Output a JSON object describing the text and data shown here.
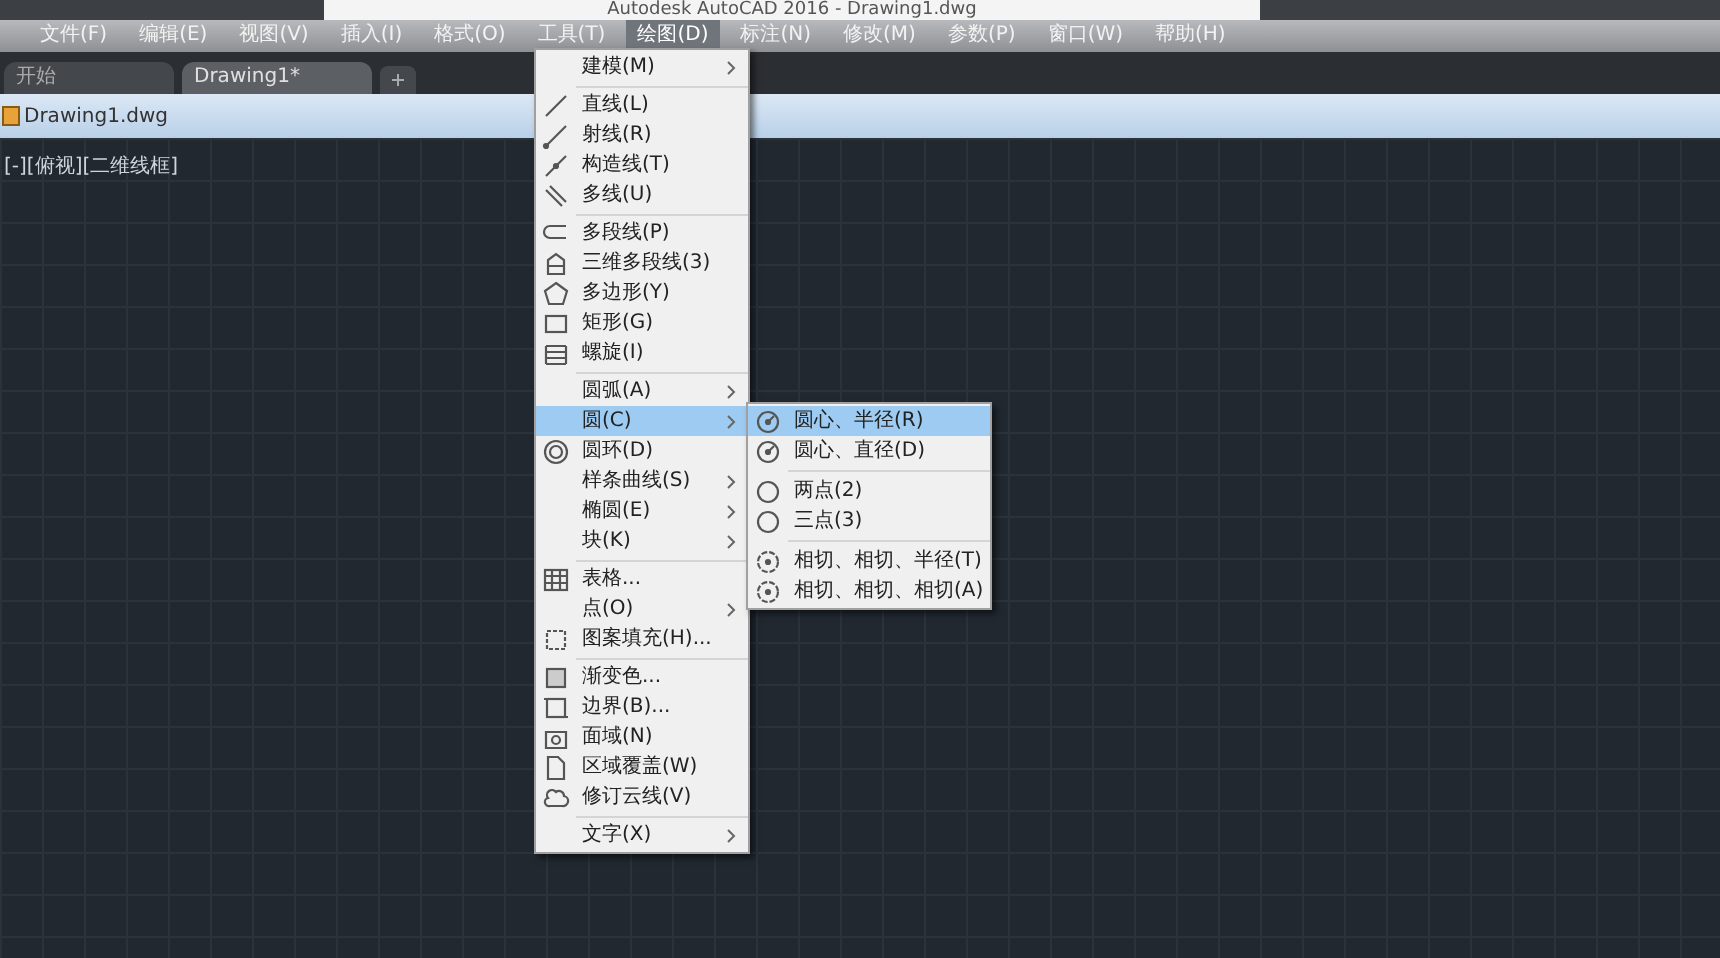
{
  "window": {
    "title": "Autodesk AutoCAD 2016 - Drawing1.dwg"
  },
  "menubar": [
    {
      "label": "文件(F)",
      "selected": false
    },
    {
      "label": "编辑(E)",
      "selected": false
    },
    {
      "label": "视图(V)",
      "selected": false
    },
    {
      "label": "插入(I)",
      "selected": false
    },
    {
      "label": "格式(O)",
      "selected": false
    },
    {
      "label": "工具(T)",
      "selected": false
    },
    {
      "label": "绘图(D)",
      "selected": true
    },
    {
      "label": "标注(N)",
      "selected": false
    },
    {
      "label": "修改(M)",
      "selected": false
    },
    {
      "label": "参数(P)",
      "selected": false
    },
    {
      "label": "窗口(W)",
      "selected": false
    },
    {
      "label": "帮助(H)",
      "selected": false
    }
  ],
  "file_tabs": [
    {
      "label": "开始",
      "selected": false
    },
    {
      "label": "Drawing1*",
      "selected": true
    }
  ],
  "document": {
    "title": "Drawing1.dwg",
    "viewport_label": "[-][俯视][二维线框]"
  },
  "draw_menu": [
    {
      "kind": "item",
      "label": "建模(M)",
      "submenu": true,
      "selected": false
    },
    {
      "kind": "separator"
    },
    {
      "kind": "item",
      "label": "直线(L)",
      "submenu": false,
      "selected": false
    },
    {
      "kind": "item",
      "label": "射线(R)",
      "submenu": false,
      "selected": false
    },
    {
      "kind": "item",
      "label": "构造线(T)",
      "submenu": false,
      "selected": false
    },
    {
      "kind": "item",
      "label": "多线(U)",
      "submenu": false,
      "selected": false
    },
    {
      "kind": "separator"
    },
    {
      "kind": "item",
      "label": "多段线(P)",
      "submenu": false,
      "selected": false
    },
    {
      "kind": "item",
      "label": "三维多段线(3)",
      "submenu": false,
      "selected": false
    },
    {
      "kind": "item",
      "label": "多边形(Y)",
      "submenu": false,
      "selected": false
    },
    {
      "kind": "item",
      "label": "矩形(G)",
      "submenu": false,
      "selected": false
    },
    {
      "kind": "item",
      "label": "螺旋(I)",
      "submenu": false,
      "selected": false
    },
    {
      "kind": "separator"
    },
    {
      "kind": "item",
      "label": "圆弧(A)",
      "submenu": true,
      "selected": false
    },
    {
      "kind": "item",
      "label": "圆(C)",
      "submenu": true,
      "selected": true
    },
    {
      "kind": "item",
      "label": "圆环(D)",
      "submenu": false,
      "selected": false
    },
    {
      "kind": "item",
      "label": "样条曲线(S)",
      "submenu": true,
      "selected": false
    },
    {
      "kind": "item",
      "label": "椭圆(E)",
      "submenu": true,
      "selected": false
    },
    {
      "kind": "item",
      "label": "块(K)",
      "submenu": true,
      "selected": false
    },
    {
      "kind": "separator"
    },
    {
      "kind": "item",
      "label": "表格...",
      "submenu": false,
      "selected": false
    },
    {
      "kind": "item",
      "label": "点(O)",
      "submenu": true,
      "selected": false
    },
    {
      "kind": "item",
      "label": "图案填充(H)...",
      "submenu": false,
      "selected": false
    },
    {
      "kind": "separator"
    },
    {
      "kind": "item",
      "label": "渐变色...",
      "submenu": false,
      "selected": false
    },
    {
      "kind": "item",
      "label": "边界(B)...",
      "submenu": false,
      "selected": false
    },
    {
      "kind": "item",
      "label": "面域(N)",
      "submenu": false,
      "selected": false
    },
    {
      "kind": "item",
      "label": "区域覆盖(W)",
      "submenu": false,
      "selected": false
    },
    {
      "kind": "item",
      "label": "修订云线(V)",
      "submenu": false,
      "selected": false
    },
    {
      "kind": "separator"
    },
    {
      "kind": "item",
      "label": "文字(X)",
      "submenu": true,
      "selected": false
    }
  ],
  "circle_submenu": [
    {
      "kind": "item",
      "label": "圆心、半径(R)",
      "selected": true
    },
    {
      "kind": "item",
      "label": "圆心、直径(D)",
      "selected": false
    },
    {
      "kind": "separator"
    },
    {
      "kind": "item",
      "label": "两点(2)",
      "selected": false
    },
    {
      "kind": "item",
      "label": "三点(3)",
      "selected": false
    },
    {
      "kind": "separator"
    },
    {
      "kind": "item",
      "label": "相切、相切、半径(T)",
      "selected": false
    },
    {
      "kind": "item",
      "label": "相切、相切、相切(A)",
      "selected": false
    }
  ]
}
